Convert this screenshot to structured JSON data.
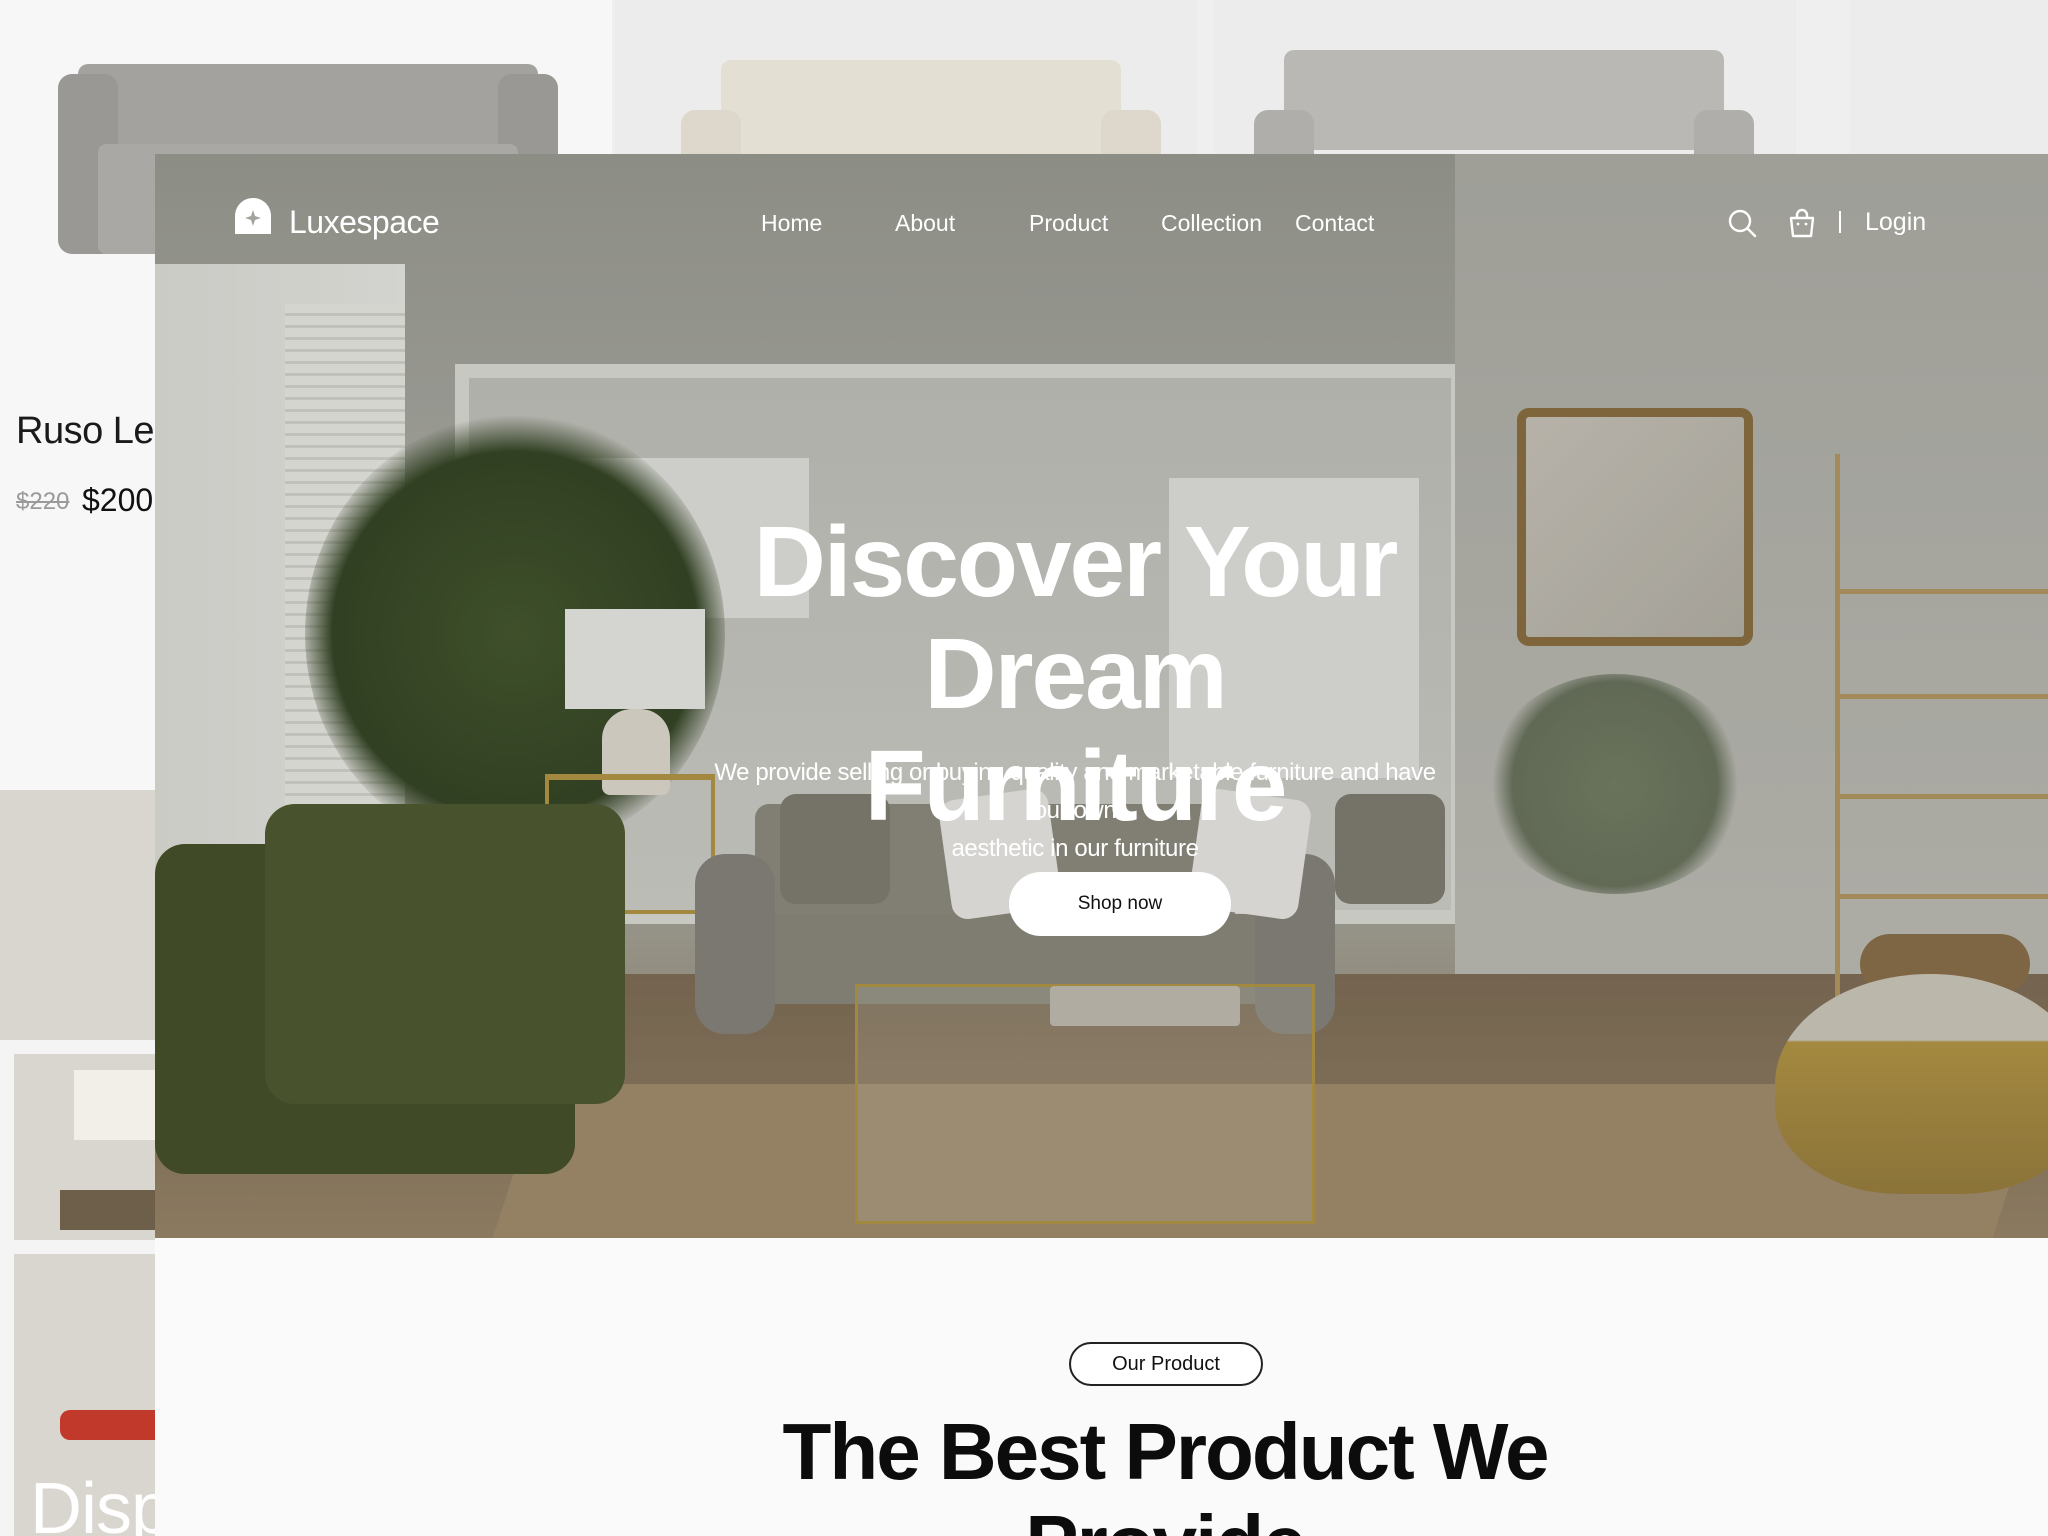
{
  "background_card": {
    "product_name": "Ruso Lea",
    "old_price": "$220",
    "new_price": "$200",
    "lower_title": "Displa"
  },
  "nav": {
    "brand": "Luxespace",
    "links": [
      "Home",
      "About",
      "Product",
      "Collection",
      "Contact"
    ],
    "search_icon": "search-icon",
    "cart_icon": "shopping-bag-icon",
    "login_label": "Login"
  },
  "hero": {
    "title_line1": "Discover Your",
    "title_line2": "Dream Furniture",
    "subtitle_line1": "We provide selling or buying quality and marketable furniture and have our own",
    "subtitle_line2": "aesthetic in our furniture",
    "cta_label": "Shop now"
  },
  "products_section": {
    "badge": "Our Product",
    "title": "The Best Product We Provide"
  },
  "colors": {
    "brand_text": "#ffffff",
    "sofa_green": "#3f4b22",
    "accent_gold": "#b8973f"
  }
}
